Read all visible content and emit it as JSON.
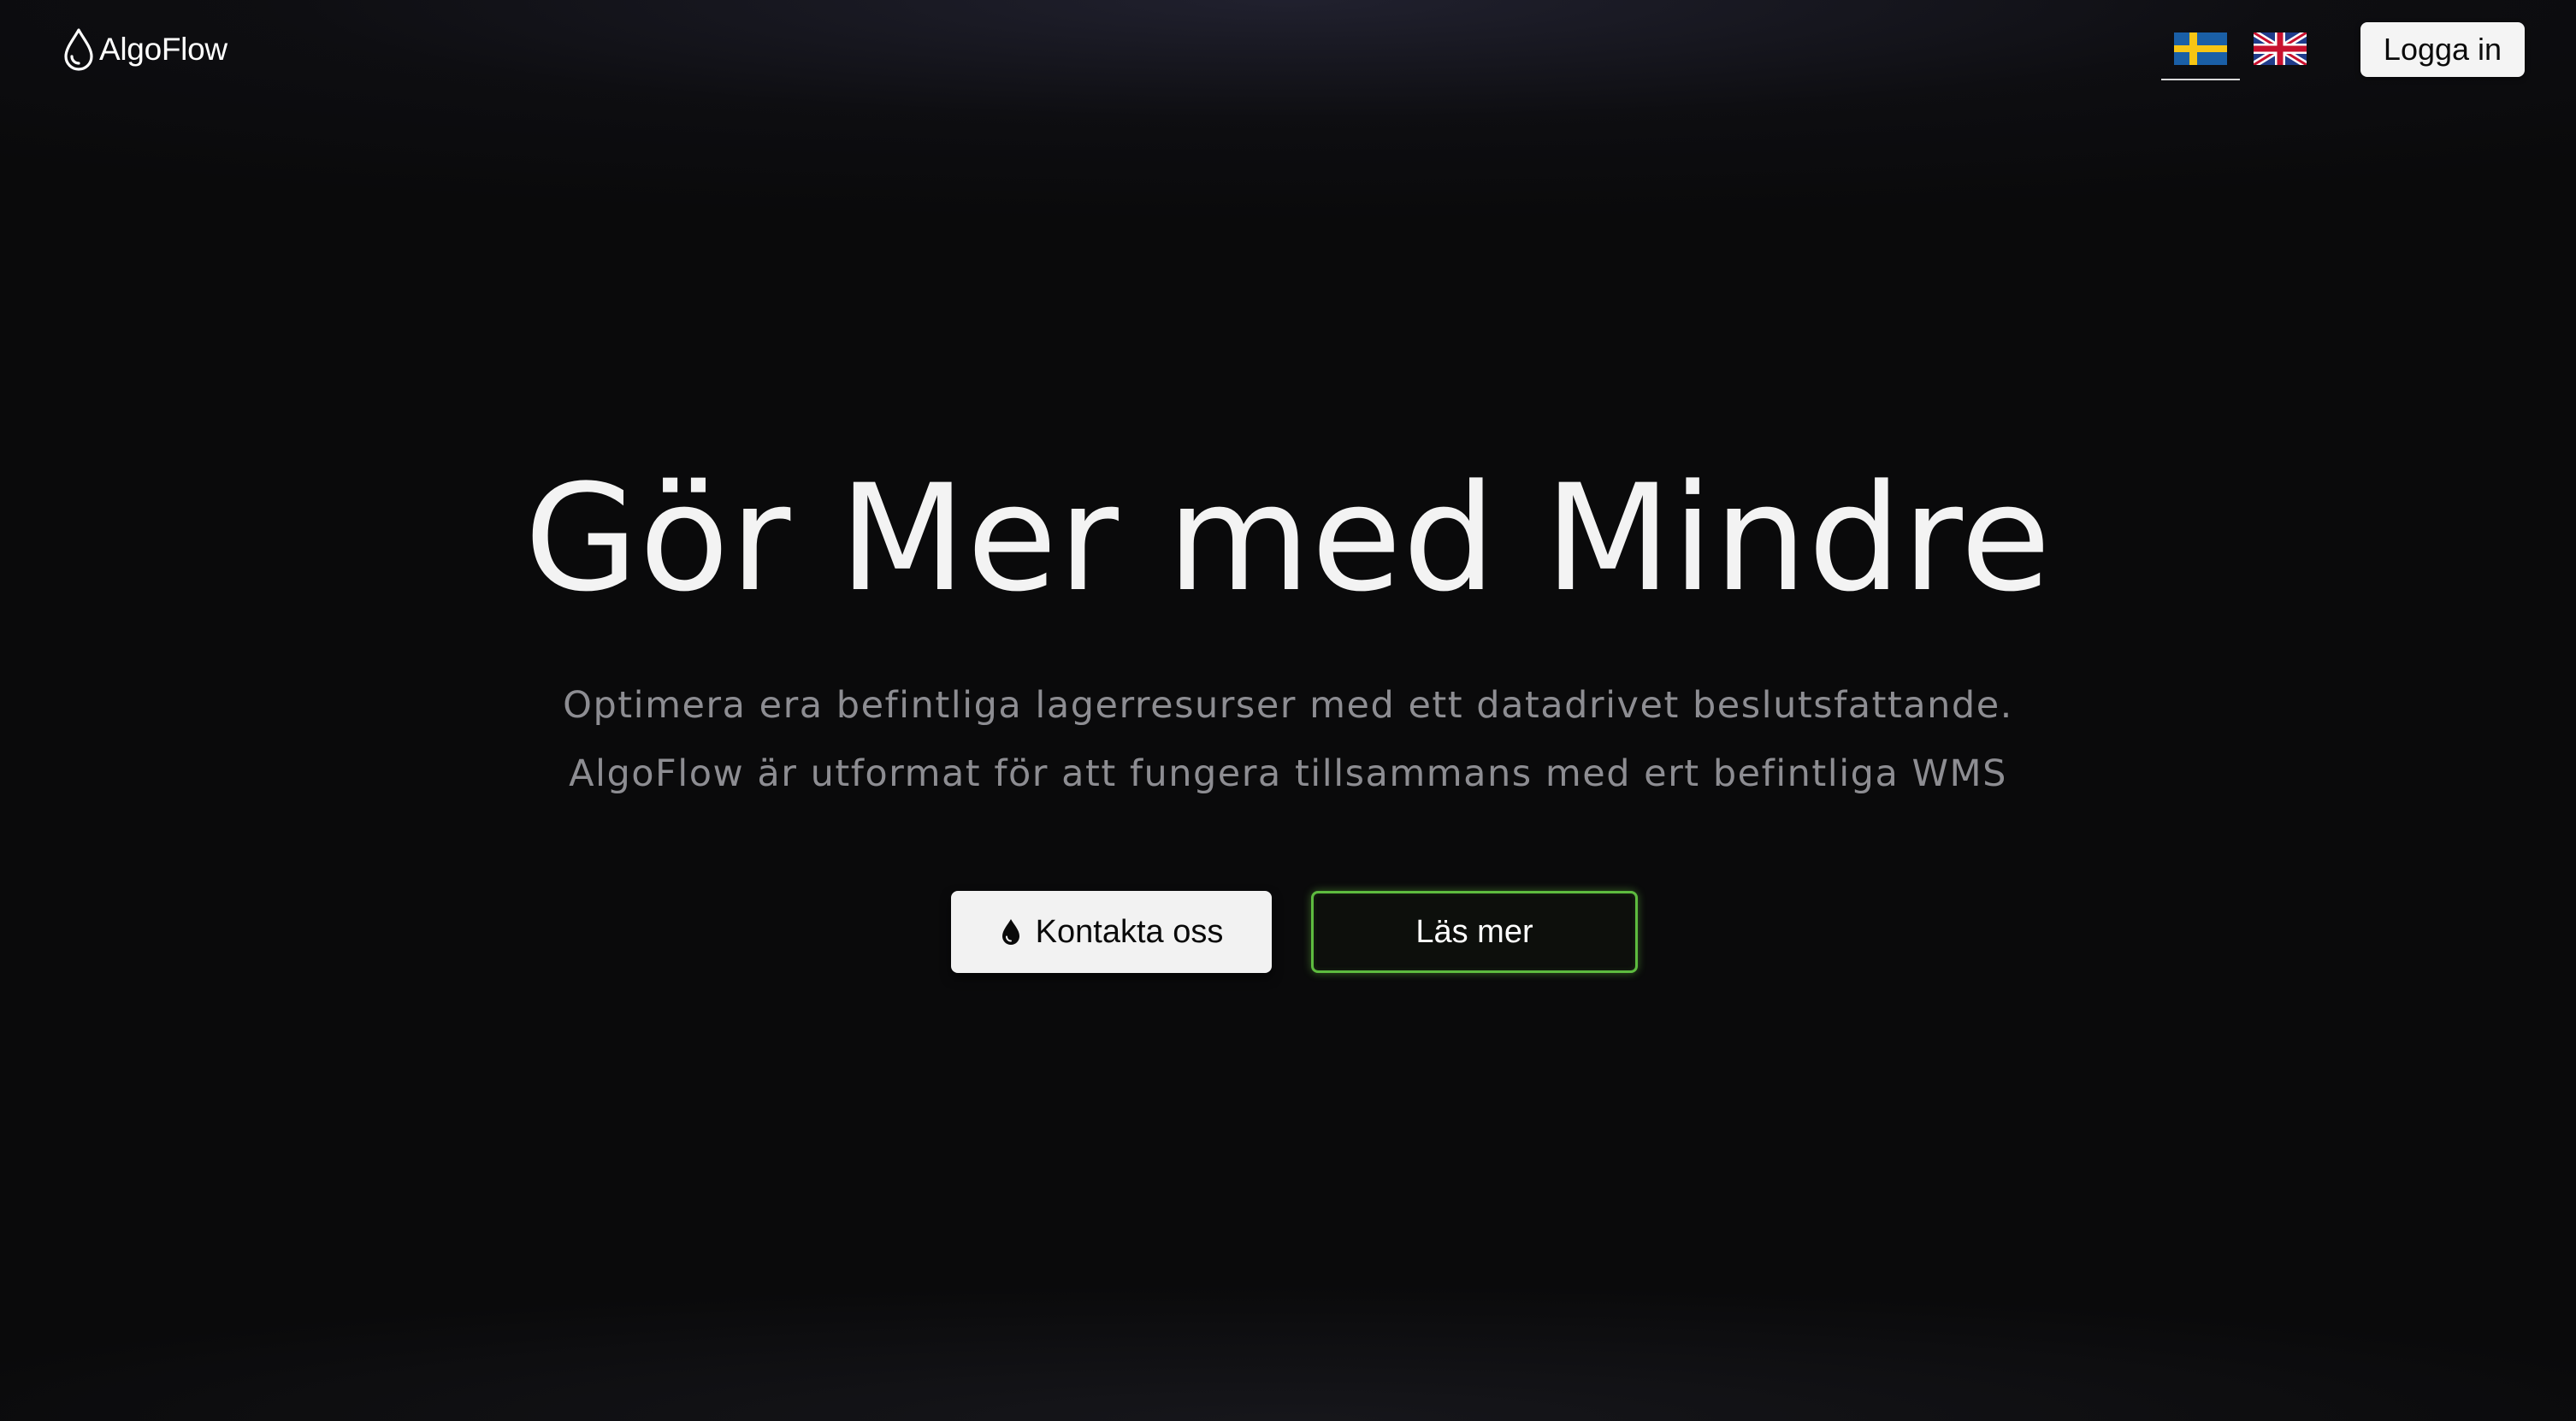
{
  "header": {
    "brand": "AlgoFlow",
    "brand_icon": "droplet-outline-icon",
    "languages": [
      {
        "code": "sv",
        "icon": "sweden-flag-icon",
        "active": true
      },
      {
        "code": "en",
        "icon": "uk-flag-icon",
        "active": false
      }
    ],
    "login_label": "Logga in"
  },
  "hero": {
    "title": "Gör Mer med Mindre",
    "subtitle_line1": "Optimera era befintliga lagerresurser med ett datadrivet beslutsfattande.",
    "subtitle_line2": "AlgoFlow är utformat för att fungera tillsammans med ert befintliga WMS",
    "primary_cta": {
      "label": "Kontakta oss",
      "icon": "droplet-filled-icon"
    },
    "secondary_cta": {
      "label": "Läs mer"
    }
  },
  "colors": {
    "background": "#0a0a0b",
    "title": "#f3f3f3",
    "subtitle": "#8d8d92",
    "button_light": "#f2f2f2",
    "accent_green": "#5dbb3f"
  }
}
